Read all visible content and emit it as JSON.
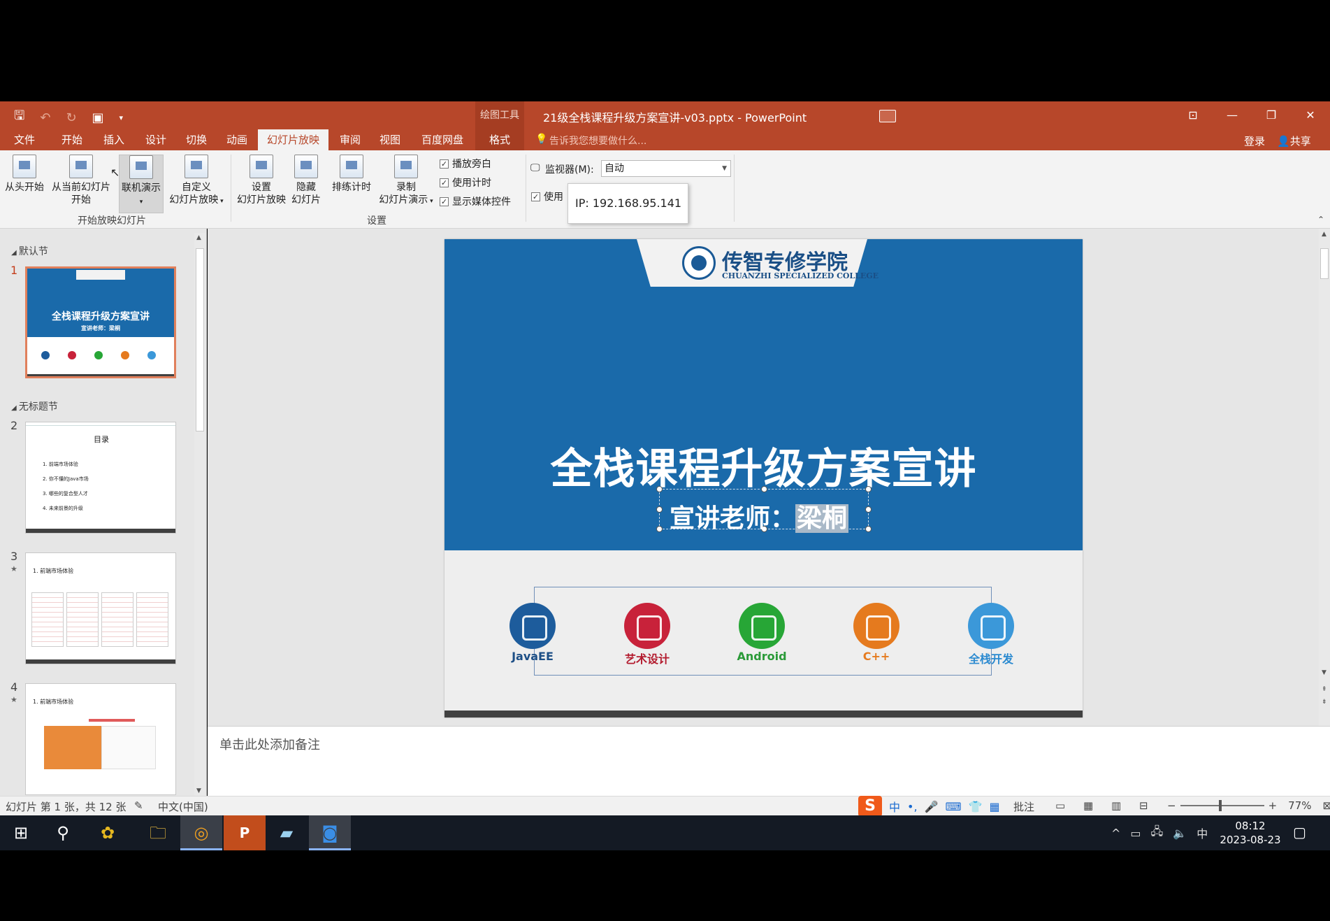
{
  "titlebar": {
    "context_tab": "绘图工具",
    "title": "21级全栈课程升级方案宣讲-v03.pptx - PowerPoint",
    "qat": [
      "save",
      "undo",
      "redo",
      "present-from-beginning",
      "customize"
    ],
    "window_buttons": [
      "restore-ribbon-icon",
      "minimize-icon",
      "restore-icon",
      "close-icon"
    ]
  },
  "tabs": {
    "items": [
      "文件",
      "开始",
      "插入",
      "设计",
      "切换",
      "动画",
      "幻灯片放映",
      "审阅",
      "视图",
      "百度网盘",
      "格式"
    ],
    "active": "幻灯片放映",
    "tell_me": "告诉我您想要做什么...",
    "login": "登录",
    "share": "共享"
  },
  "ribbon": {
    "from_beginning": "从头开始",
    "from_current_1": "从当前幻灯片",
    "from_current_2": "开始",
    "online_present": "联机演示",
    "custom_1": "自定义",
    "custom_2": "幻灯片放映",
    "group_start": "开始放映幻灯片",
    "setup_1": "设置",
    "setup_2": "幻灯片放映",
    "hide_1": "隐藏",
    "hide_2": "幻灯片",
    "rehearse": "排练计时",
    "record_1": "录制",
    "record_2": "幻灯片演示",
    "chk_narration": "播放旁白",
    "chk_timings": "使用计时",
    "chk_media": "显示媒体控件",
    "group_setup": "设置",
    "monitor_label": "监视器(M):",
    "monitor_value": "自动",
    "use_presenter": "使用",
    "tooltip": "IP: 192.168.95.141"
  },
  "thumbs": {
    "section_default": "默认节",
    "section_untitled": "无标题节",
    "slide_numbers": [
      "1",
      "2",
      "3",
      "4"
    ],
    "slide1_title": "全栈课程升级方案宣讲",
    "slide1_sub": "宣讲老师：梁桐",
    "slide2_heading": "目录",
    "slide2_items": [
      "1. 前端市场体验",
      "2. 你不懂的Java市场",
      "3. 哪些的复合型人才",
      "4. 未来前景的升级"
    ],
    "slide3_heading": "1. 前端市场体验",
    "slide4_heading": "1. 前端市场体验"
  },
  "slide": {
    "school_cn": "传智专修学院",
    "school_en": "CHUANZHI SPECIALIZED COLLEGE",
    "title": "全栈课程升级方案宣讲",
    "sub_prefix": "宣讲老师：",
    "sub_name": "梁桐",
    "icons": [
      {
        "label": "JavaEE",
        "color": "#1d5c9c"
      },
      {
        "label": "艺术设计",
        "color": "#c8223a"
      },
      {
        "label": "Android",
        "color": "#27a636"
      },
      {
        "label": "C++",
        "color": "#e57a1e"
      },
      {
        "label": "全栈开发",
        "color": "#3b98d9"
      }
    ]
  },
  "notes_placeholder": "单击此处添加备注",
  "status": {
    "slide_info": "幻灯片 第 1 张，共 12 张",
    "language": "中文(中国)",
    "comments": "批注",
    "zoom": "77%",
    "ime_mode": "中"
  },
  "taskbar": {
    "time": "08:12",
    "date": "2023-08-23",
    "ime": "中"
  },
  "colors": {
    "accent": "#b7472a",
    "slide_blue": "#1a6aaa"
  }
}
